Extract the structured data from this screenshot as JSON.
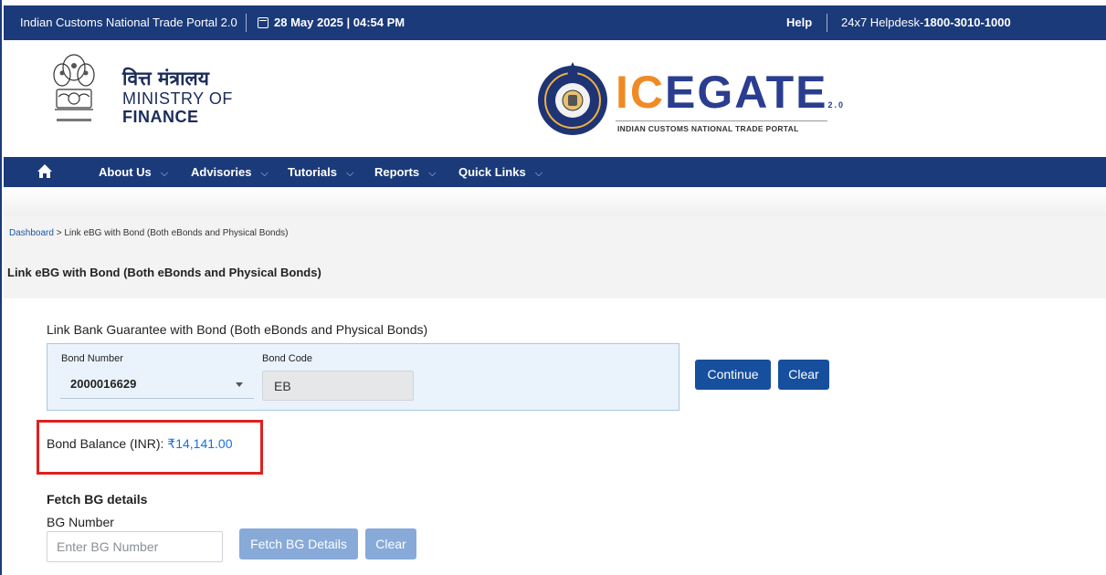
{
  "topbar": {
    "portal_name": "Indian Customs National Trade Portal 2.0",
    "datetime": "28 May 2025 | 04:54 PM",
    "help": "Help",
    "helpdesk_label": "24x7 Helpdesk-",
    "helpdesk_number": "1800-3010-1000",
    "calendar_icon": "calendar-icon"
  },
  "header": {
    "ministry_hindi": "वित्त मंत्रालय",
    "ministry_line1": "MINISTRY OF",
    "ministry_line2": "FINANCE",
    "emblem_icon": "national-emblem-icon",
    "seal_icon": "customs-seal-icon",
    "logo_orange": "IC",
    "logo_blue": "EGATE",
    "logo_version": "2.0",
    "logo_tagline": "INDIAN CUSTOMS NATIONAL TRADE PORTAL"
  },
  "nav": {
    "home_icon": "home-icon",
    "items": [
      {
        "label": "About Us"
      },
      {
        "label": "Advisories"
      },
      {
        "label": "Tutorials"
      },
      {
        "label": "Reports"
      },
      {
        "label": "Quick Links"
      }
    ]
  },
  "breadcrumb": {
    "root": "Dashboard",
    "separator": ">",
    "current": "Link eBG with Bond (Both eBonds and Physical Bonds)"
  },
  "page_title": "Link eBG with Bond (Both eBonds and Physical Bonds)",
  "form": {
    "section_title": "Link Bank Guarantee with Bond (Both eBonds and Physical Bonds)",
    "bond_number_label": "Bond Number",
    "bond_number_value": "2000016629",
    "bond_code_label": "Bond Code",
    "bond_code_value": "EB",
    "continue_label": "Continue",
    "clear_label": "Clear"
  },
  "balance": {
    "label": "Bond Balance (INR):",
    "amount": "₹14,141.00",
    "highlight_color": "#e02020"
  },
  "fetch": {
    "title": "Fetch BG details",
    "bg_number_label": "BG Number",
    "bg_number_placeholder": "Enter BG Number",
    "bg_number_value": "",
    "fetch_label": "Fetch BG Details",
    "clear_label": "Clear"
  },
  "colors": {
    "brand_navy": "#1b3a7a",
    "button_blue": "#164f9e",
    "button_disabled": "#87aad8",
    "logo_orange": "#f08a24",
    "link_blue": "#1a6fd8"
  }
}
